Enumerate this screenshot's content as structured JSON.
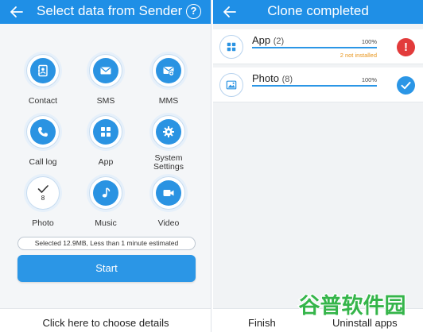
{
  "left": {
    "title": "Select data from Sender",
    "help_symbol": "?",
    "categories": [
      {
        "label": "Contact",
        "icon": "contact-book-icon"
      },
      {
        "label": "SMS",
        "icon": "envelope-icon"
      },
      {
        "label": "MMS",
        "icon": "mms-icon"
      },
      {
        "label": "Call log",
        "icon": "phone-icon"
      },
      {
        "label": "App",
        "icon": "app-grid-icon"
      },
      {
        "label": "System\nSettings",
        "icon": "gear-icon"
      },
      {
        "label": "Photo",
        "icon": "checkmark-icon",
        "count": "8",
        "selected": true
      },
      {
        "label": "Music",
        "icon": "music-note-icon"
      },
      {
        "label": "Video",
        "icon": "video-camera-icon"
      }
    ],
    "summary": "Selected 12.9MB, Less than 1 minute estimated",
    "start_label": "Start",
    "details_link": "Click here to choose details"
  },
  "right": {
    "title": "Clone completed",
    "items": [
      {
        "name": "App",
        "count": "(2)",
        "percent": "100%",
        "progress": 1.0,
        "note": "2 not installed",
        "status": "error",
        "icon": "app-grid-icon"
      },
      {
        "name": "Photo",
        "count": "(8)",
        "percent": "100%",
        "progress": 1.0,
        "note": "",
        "status": "success",
        "icon": "image-icon"
      }
    ],
    "finish_label": "Finish",
    "uninstall_label": "Uninstall apps",
    "error_symbol": "!"
  },
  "watermark_text": "谷普软件园",
  "colors": {
    "accent": "#2b96e6",
    "topbar": "#1f8fe6",
    "error": "#e23b3b",
    "warning": "#e8951c"
  }
}
